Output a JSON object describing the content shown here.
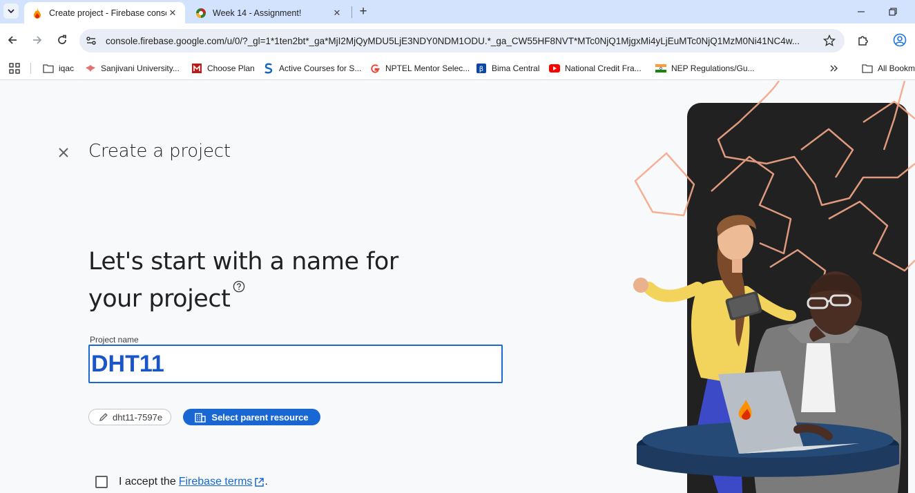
{
  "browser": {
    "tabs": [
      {
        "title": "Create project - Firebase console",
        "active": true,
        "favicon": "firebase-icon"
      },
      {
        "title": "Week 14 - Assignment!",
        "active": false,
        "favicon": "nptel-icon"
      }
    ],
    "new_tab_icon": "plus-icon",
    "window_controls": [
      "minimize-icon",
      "restore-icon",
      "close-icon"
    ],
    "url": "console.firebase.google.com/u/0/?_gl=1*1ten2bt*_ga*MjI2MjQyMDU5LjE3NDY0NDM1ODU.*_ga_CW55HF8NVT*MTc0NjQ1MjgxMi4yLjEuMTc0NjQ1MzM0Ni41NC4w...",
    "bookmarks": [
      {
        "label": "iqac",
        "icon": "folder-icon"
      },
      {
        "label": "Sanjivani University...",
        "icon": "sanjivani-icon"
      },
      {
        "label": "Choose Plan",
        "icon": "m-logo-icon"
      },
      {
        "label": "Active Courses for S...",
        "icon": "s-logo-icon"
      },
      {
        "label": "NPTEL Mentor Selec...",
        "icon": "google-icon"
      },
      {
        "label": "Bima Central",
        "icon": "bima-icon"
      },
      {
        "label": "National Credit Fra...",
        "icon": "youtube-icon"
      },
      {
        "label": "NEP Regulations/Gu...",
        "icon": "india-flag-icon"
      }
    ],
    "all_bookmarks": "All Bookmarks"
  },
  "page": {
    "title": "Create a project",
    "headline_line1": "Let's start with a name for",
    "headline_line2": "your project",
    "field_label": "Project name",
    "project_name": "DHT11",
    "project_id": "dht11-7597e",
    "select_parent_label": "Select parent resource",
    "accept_text": "I accept the",
    "terms_link": "Firebase terms",
    "accept_suffix": "."
  },
  "colors": {
    "accent": "#1967d2",
    "tab_strip": "#d3e3fd",
    "page_bg": "#f8f9fa",
    "illustration_dark": "#212121",
    "decor_orange": "#f4a688"
  }
}
